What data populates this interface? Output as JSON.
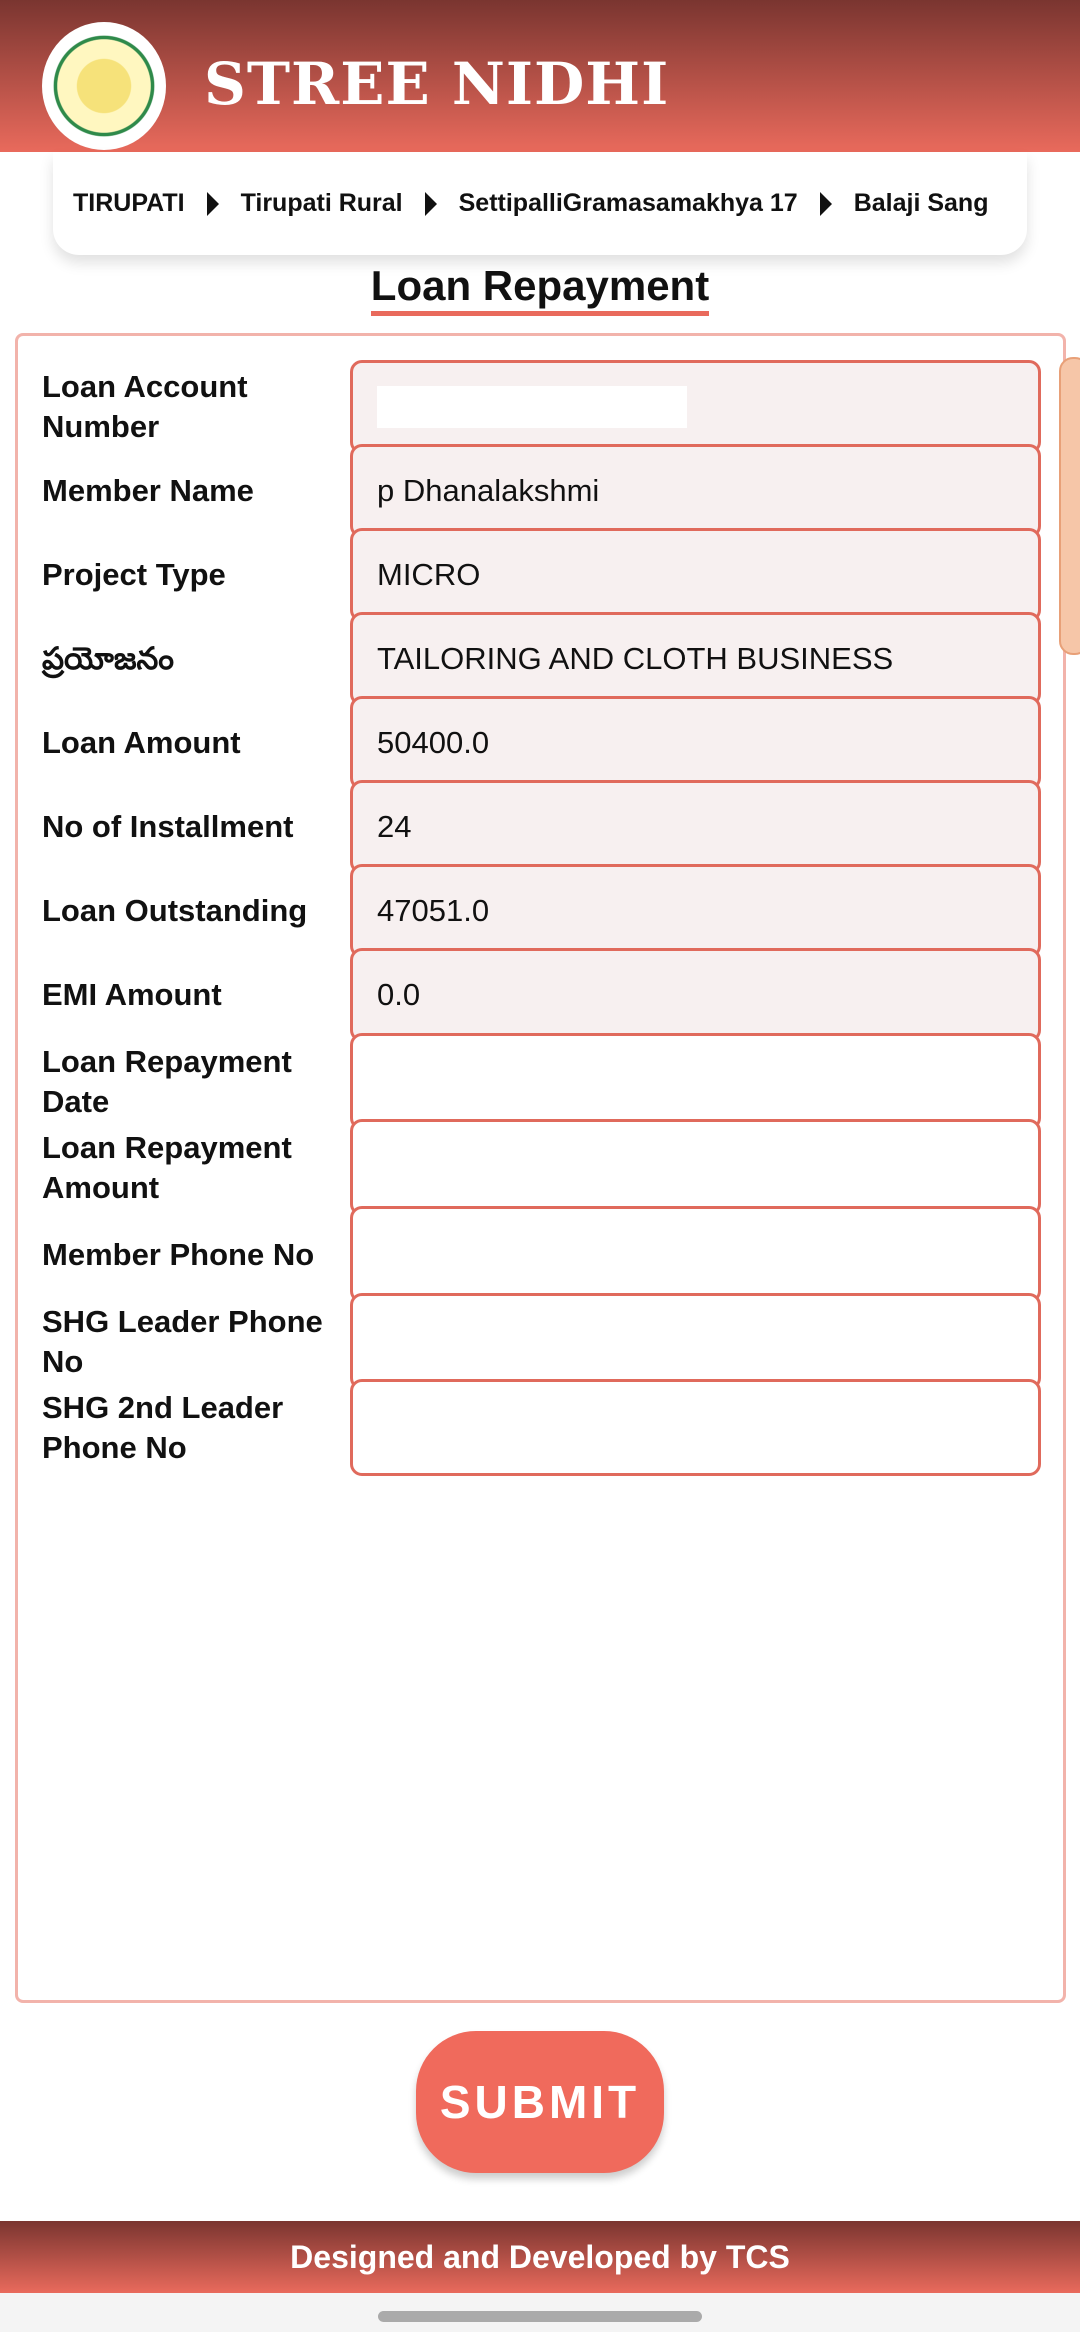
{
  "header": {
    "title": "STREE NIDHI",
    "logo_icon": "andhra-pradesh-emblem"
  },
  "breadcrumb": [
    "TIRUPATI",
    "Tirupati Rural",
    "SettipalliGramasamakhya 17",
    "Balaji Sang"
  ],
  "page_title": "Loan Repayment",
  "fields": [
    {
      "label": "Loan Account Number",
      "value": "",
      "readonly": true,
      "redacted": true
    },
    {
      "label": "Member Name",
      "value": "p Dhanalakshmi",
      "readonly": true
    },
    {
      "label": "Project Type",
      "value": "MICRO",
      "readonly": true
    },
    {
      "label": "ప్రయోజనం",
      "value": "TAILORING AND CLOTH BUSINESS",
      "readonly": true
    },
    {
      "label": "Loan Amount",
      "value": "50400.0",
      "readonly": true
    },
    {
      "label": "No of Installment",
      "value": "24",
      "readonly": true
    },
    {
      "label": "Loan Outstanding",
      "value": "47051.0",
      "readonly": true
    },
    {
      "label": "EMI Amount",
      "value": "0.0",
      "readonly": true
    },
    {
      "label": "Loan Repayment Date",
      "value": "",
      "readonly": false
    },
    {
      "label": "Loan Repayment Amount",
      "value": "",
      "readonly": false
    },
    {
      "label": "Member Phone No",
      "value": "",
      "readonly": false
    },
    {
      "label": "SHG Leader Phone No",
      "value": "",
      "readonly": false
    },
    {
      "label": "SHG 2nd Leader Phone No",
      "value": "",
      "readonly": false
    }
  ],
  "submit_label": "SUBMIT",
  "footer": "Designed and Developed by  TCS",
  "colors": {
    "accent": "#f06a5c",
    "header_dark": "#7a3530",
    "border": "#e06a5c"
  }
}
